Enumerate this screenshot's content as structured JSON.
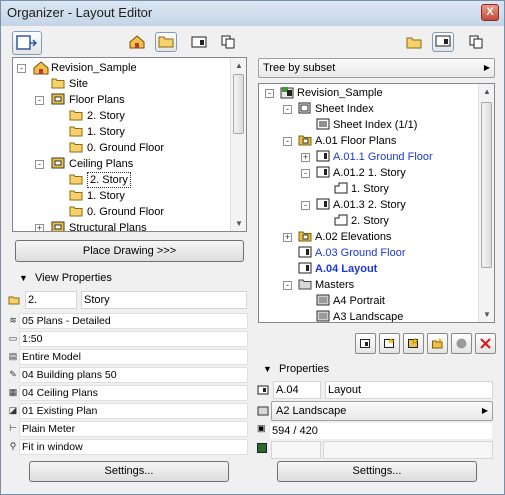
{
  "window": {
    "title": "Organizer - Layout Editor",
    "close_glyph": "X"
  },
  "left": {
    "tree": [
      {
        "label": "Revision_Sample",
        "icon": "project-icon",
        "level": 0,
        "exp": "−"
      },
      {
        "label": "Site",
        "icon": "folder-icon",
        "level": 1
      },
      {
        "label": "Floor Plans",
        "icon": "plan-folder-icon",
        "level": 1,
        "exp": "−"
      },
      {
        "label": "2. Story",
        "icon": "folder-icon",
        "level": 2
      },
      {
        "label": "1. Story",
        "icon": "folder-icon",
        "level": 2
      },
      {
        "label": "0. Ground Floor",
        "icon": "folder-icon",
        "level": 2
      },
      {
        "label": "Ceiling Plans",
        "icon": "plan-folder-icon",
        "level": 1,
        "exp": "−"
      },
      {
        "label": "2. Story",
        "icon": "folder-icon",
        "level": 2,
        "selected": true
      },
      {
        "label": "1. Story",
        "icon": "folder-icon",
        "level": 2
      },
      {
        "label": "0. Ground Floor",
        "icon": "folder-icon",
        "level": 2
      },
      {
        "label": "Structural Plans",
        "icon": "plan-folder-icon",
        "level": 1,
        "exp": "+"
      }
    ],
    "place_button": "Place Drawing >>>",
    "view_properties": {
      "header": "View Properties",
      "id_value": "2.",
      "name_value": "Story",
      "rows": [
        {
          "icon": "layer-combo-icon",
          "value": "05 Plans - Detailed"
        },
        {
          "icon": "scale-icon",
          "value": "1:50"
        },
        {
          "icon": "structure-icon",
          "value": "Entire Model"
        },
        {
          "icon": "pen-set-icon",
          "value": "04 Building plans 50"
        },
        {
          "icon": "mvo-icon",
          "value": "04 Ceiling Plans"
        },
        {
          "icon": "renovation-icon",
          "value": "01 Existing Plan"
        },
        {
          "icon": "dimension-icon",
          "value": "Plain Meter"
        },
        {
          "icon": "zoom-icon",
          "value": "Fit in window"
        }
      ],
      "settings_button": "Settings..."
    }
  },
  "right": {
    "mode_select": "Tree by subset",
    "tree": [
      {
        "label": "Revision_Sample",
        "level": 0,
        "exp": "−",
        "icon": "book-icon"
      },
      {
        "label": "Sheet Index",
        "level": 1,
        "exp": "−",
        "icon": "sheet-icon"
      },
      {
        "label": "Sheet Index (1/1)",
        "level": 2,
        "icon": "index-icon"
      },
      {
        "label": "A.01 Floor Plans",
        "level": 1,
        "exp": "−",
        "icon": "subset-icon"
      },
      {
        "label": "A.01.1 Ground Floor",
        "level": 2,
        "exp": "+",
        "icon": "layout-icon",
        "style": "blue"
      },
      {
        "label": "A.01.2 1. Story",
        "level": 2,
        "exp": "−",
        "icon": "layout-icon"
      },
      {
        "label": "1. Story",
        "level": 3,
        "icon": "drawing-icon"
      },
      {
        "label": "A.01.3 2. Story",
        "level": 2,
        "exp": "−",
        "icon": "layout-icon"
      },
      {
        "label": "2. Story",
        "level": 3,
        "icon": "drawing-icon"
      },
      {
        "label": "A.02 Elevations",
        "level": 1,
        "exp": "+",
        "icon": "subset-icon"
      },
      {
        "label": "A.03 Ground Floor",
        "level": 1,
        "icon": "layout-icon",
        "style": "blue"
      },
      {
        "label": "A.04 Layout",
        "level": 1,
        "icon": "layout-icon",
        "style": "blue-bold"
      },
      {
        "label": "Masters",
        "level": 1,
        "exp": "−",
        "icon": "masters-icon"
      },
      {
        "label": "A4 Portrait",
        "level": 2,
        "icon": "master-icon"
      },
      {
        "label": "A3 Landscape",
        "level": 2,
        "icon": "master-icon"
      }
    ],
    "properties": {
      "header": "Properties",
      "id_value": "A.04",
      "name_value": "Layout",
      "master_value": "A2 Landscape",
      "size_value": "594 / 420",
      "settings_button": "Settings..."
    }
  }
}
